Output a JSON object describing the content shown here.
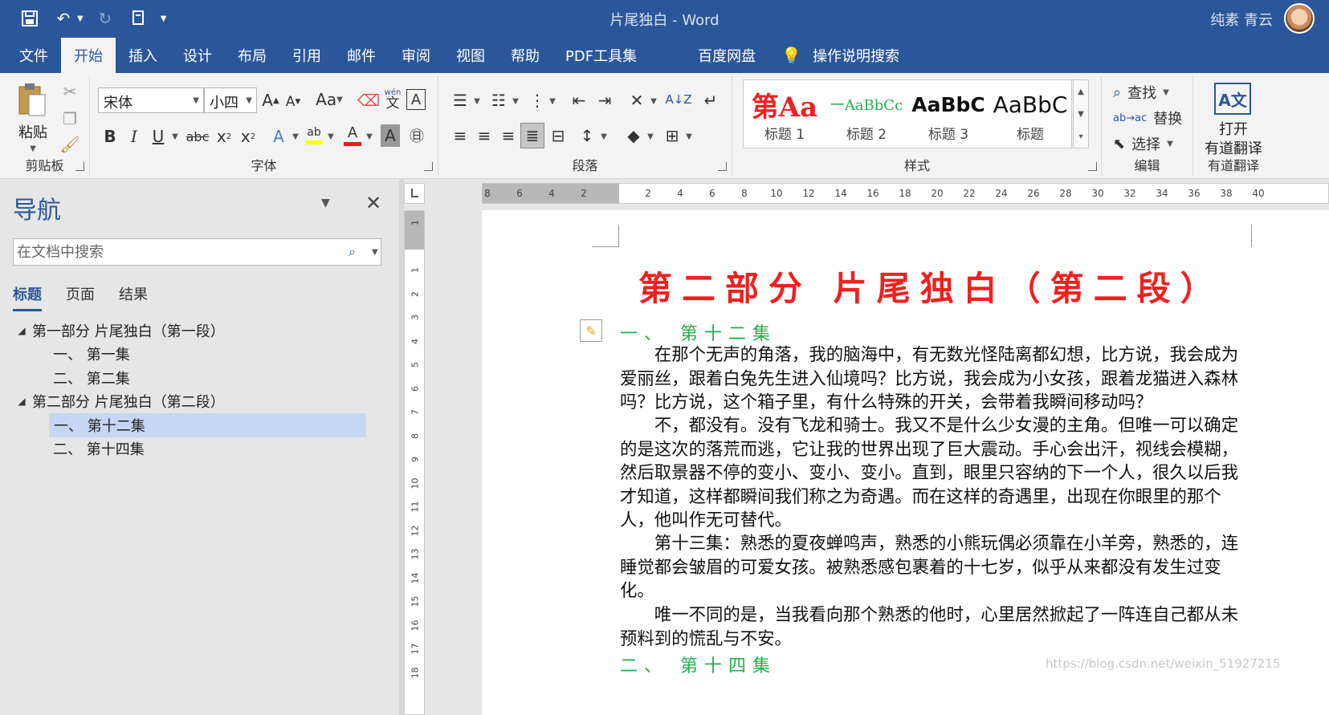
{
  "window": {
    "title": "片尾独白  -  Word",
    "user": "纯素 青云"
  },
  "tabs": [
    {
      "label": "文件"
    },
    {
      "label": "开始"
    },
    {
      "label": "插入"
    },
    {
      "label": "设计"
    },
    {
      "label": "布局"
    },
    {
      "label": "引用"
    },
    {
      "label": "邮件"
    },
    {
      "label": "审阅"
    },
    {
      "label": "视图"
    },
    {
      "label": "帮助"
    },
    {
      "label": "PDF工具集"
    },
    {
      "label": "百度网盘"
    },
    {
      "label": "操作说明搜索"
    }
  ],
  "ribbon": {
    "clipboard": {
      "label": "剪贴板",
      "paste": "粘贴"
    },
    "font": {
      "label": "字体",
      "font_name": "宋体",
      "font_size": "小四",
      "wen": "wén",
      "wen_char": "文"
    },
    "paragraph": {
      "label": "段落"
    },
    "styles": {
      "label": "样式",
      "items": [
        {
          "sample": "第Aa",
          "name": "标题 1"
        },
        {
          "sample": "一AaBbCc",
          "name": "标题 2"
        },
        {
          "sample": "AaBbC",
          "name": "标题 3"
        },
        {
          "sample": "AaBbC",
          "name": "标题"
        }
      ]
    },
    "editing": {
      "label": "编辑",
      "find": "查找",
      "replace": "替换",
      "select": "选择"
    },
    "youdao": {
      "label": "有道翻译",
      "open_line1": "打开",
      "open_line2": "有道翻译"
    }
  },
  "nav": {
    "title": "导航",
    "search_placeholder": "在文档中搜索",
    "tabs": [
      "标题",
      "页面",
      "结果"
    ],
    "tree": [
      {
        "label": "第一部分 片尾独白（第一段）"
      },
      {
        "label": "一、 第一集"
      },
      {
        "label": "二、 第二集"
      },
      {
        "label": "第二部分 片尾独白（第二段）"
      },
      {
        "label": "一、 第十二集"
      },
      {
        "label": "二、 第十四集"
      }
    ]
  },
  "ruler": {
    "h": [
      "8",
      "6",
      "4",
      "2",
      "",
      "2",
      "4",
      "6",
      "8",
      "10",
      "12",
      "14",
      "16",
      "18",
      "20",
      "22",
      "24",
      "26",
      "28",
      "30",
      "32",
      "34",
      "36",
      "38",
      "40"
    ],
    "v": [
      "1",
      "",
      "1",
      "2",
      "3",
      "4",
      "5",
      "6",
      "7",
      "8",
      "9",
      "10",
      "11",
      "12",
      "13",
      "14",
      "15",
      "16",
      "17",
      "18"
    ]
  },
  "document": {
    "title": "第二部分 片尾独白（第二段）",
    "heading1": "一、 第十二集",
    "paragraphs": [
      "在那个无声的角落，我的脑海中，有无数光怪陆离都幻想，比方说，我会成为爱丽丝，跟着白兔先生进入仙境吗？比方说，我会成为小女孩，跟着龙猫进入森林吗？比方说，这个箱子里，有什么特殊的开关，会带着我瞬间移动吗？",
      "不，都没有。没有飞龙和骑士。我又不是什么少女漫的主角。但唯一可以确定的是这次的落荒而逃，它让我的世界出现了巨大震动。手心会出汗，视线会模糊，然后取景器不停的变小、变小、变小。直到，眼里只容纳的下一个人，很久以后我才知道，这样都瞬间我们称之为奇遇。而在这样的奇遇里，出现在你眼里的那个人，他叫作无可替代。",
      "第十三集：熟悉的夏夜蝉鸣声，熟悉的小熊玩偶必须靠在小羊旁，熟悉的，连睡觉都会皱眉的可爱女孩。被熟悉感包裹着的十七岁，似乎从来都没有发生过变化。",
      "唯一不同的是，当我看向那个熟悉的他时，心里居然掀起了一阵连自己都从未预料到的慌乱与不安。"
    ],
    "heading2": "二、 第十四集"
  },
  "watermark": "https://blog.csdn.net/weixin_51927215",
  "colors": {
    "brand": "#2b579a",
    "title_red": "#f02020",
    "heading_green": "#22b04c",
    "selected": "#c5d7f2"
  }
}
